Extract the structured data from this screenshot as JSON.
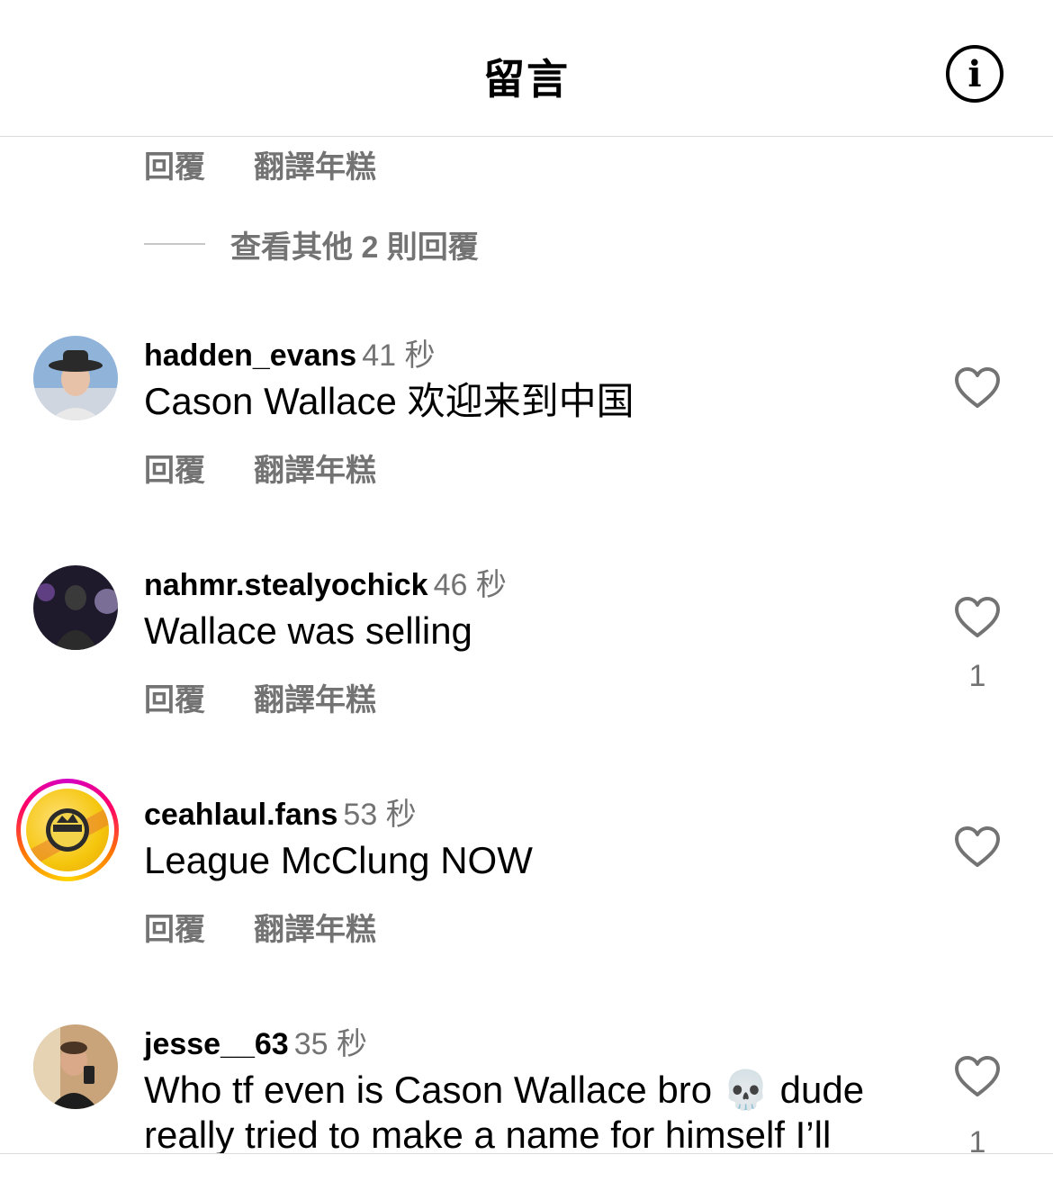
{
  "header": {
    "title": "留言",
    "info_icon": "info-circle-icon"
  },
  "top_actions": {
    "reply": "回覆",
    "translate": "翻譯年糕"
  },
  "view_more": {
    "text": "查看其他 2 則回覆"
  },
  "comments": [
    {
      "username": "hadden_evans",
      "time": "41 秒",
      "text": "Cason Wallace 欢迎来到中国",
      "reply": "回覆",
      "translate": "翻譯年糕",
      "likes": ""
    },
    {
      "username": "nahmr.stealyochick",
      "time": "46 秒",
      "text": "Wallace was selling",
      "reply": "回覆",
      "translate": "翻譯年糕",
      "likes": "1"
    },
    {
      "username": "ceahlaul.fans",
      "time": "53 秒",
      "text": "League McClung NOW",
      "reply": "回覆",
      "translate": "翻譯年糕",
      "likes": ""
    },
    {
      "username": "jesse__63",
      "time": "35 秒",
      "text_line1": "Who tf even is Cason Wallace bro 💀 dude",
      "text_line2": "really tried to make a name for himself I’ll",
      "likes": "1"
    }
  ],
  "colors": {
    "secondary_text": "#737373",
    "divider": "#dbdbdb",
    "story_ring": [
      "#d300c5",
      "#ff0069",
      "#ff7a00",
      "#ffd600"
    ]
  }
}
